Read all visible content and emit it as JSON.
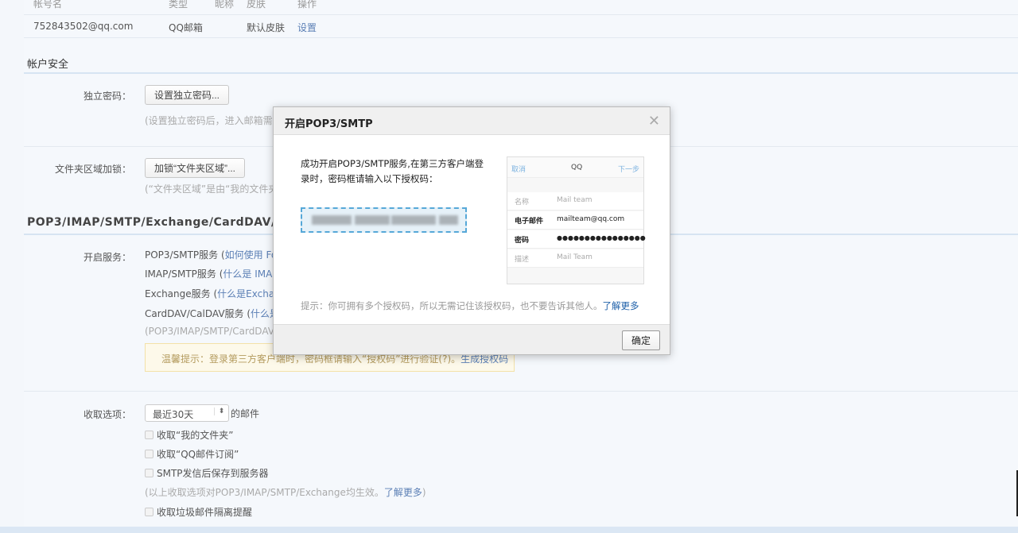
{
  "account_table": {
    "headers": [
      "帐号名",
      "类型",
      "昵称",
      "皮肤",
      "操作"
    ],
    "row": {
      "account": "752843502@qq.com",
      "type": "QQ邮箱",
      "skin": "默认皮肤",
      "action": "设置"
    }
  },
  "security": {
    "title": "帐户安全",
    "independent_password": {
      "label": "独立密码：",
      "button": "设置独立密码...",
      "hint": "(设置独立密码后，进入邮箱需要"
    },
    "folder_lock": {
      "label": "文件夹区域加锁：",
      "button": "加锁“文件夹区域”...",
      "hint": "(“文件夹区域”是由“我的文件夹"
    }
  },
  "services": {
    "title": "POP3/IMAP/SMTP/Exchange/CardDAV/",
    "label": "开启服务：",
    "items": [
      {
        "name": "POP3/SMTP服务 (",
        "link": "如何使用 Fo"
      },
      {
        "name": "IMAP/SMTP服务 (",
        "link": "什么是 IMA"
      },
      {
        "name": "Exchange服务 (",
        "link": "什么是Exchan"
      },
      {
        "name": "CardDAV/CalDAV服务 (",
        "link": "什么是"
      }
    ],
    "note": "(POP3/IMAP/SMTP/CardDAV",
    "warning": "温馨提示：登录第三方客户端时，密码框请输入“授权码”进行验证(?)。",
    "warning_link": "生成授权码"
  },
  "receive": {
    "label": "收取选项：",
    "select": "最近30天",
    "select_suffix": "的邮件",
    "options": [
      {
        "label": "收取“我的文件夹”",
        "checked": false
      },
      {
        "label": "收取“QQ邮件订阅”",
        "checked": false
      },
      {
        "label": "SMTP发信后保存到服务器",
        "checked": false
      }
    ],
    "note": "(以上收取选项对POP3/IMAP/SMTP/Exchange均生效。",
    "note_link": "了解更多",
    "note_end": ")",
    "spam": {
      "label": "收取垃圾邮件隔离提醒",
      "checked": false
    }
  },
  "modal": {
    "title": "开启POP3/SMTP",
    "message": "成功开启POP3/SMTP服务,在第三方客户端登录时，密码框请输入以下授权码：",
    "tip": "提示：你可拥有多个授权码，所以无需记住该授权码，也不要告诉其他人。",
    "tip_link": "了解更多",
    "ok": "确定",
    "phone": {
      "cancel": "取消",
      "title": "QQ",
      "next": "下一步",
      "rows": [
        {
          "k": "名称",
          "v": "Mail team"
        },
        {
          "k": "电子邮件",
          "v": "mailteam@qq.com"
        },
        {
          "k": "密码",
          "v": "●●●●●●●●●●●●●●●●"
        },
        {
          "k": "描述",
          "v": "Mail Team"
        }
      ]
    }
  }
}
